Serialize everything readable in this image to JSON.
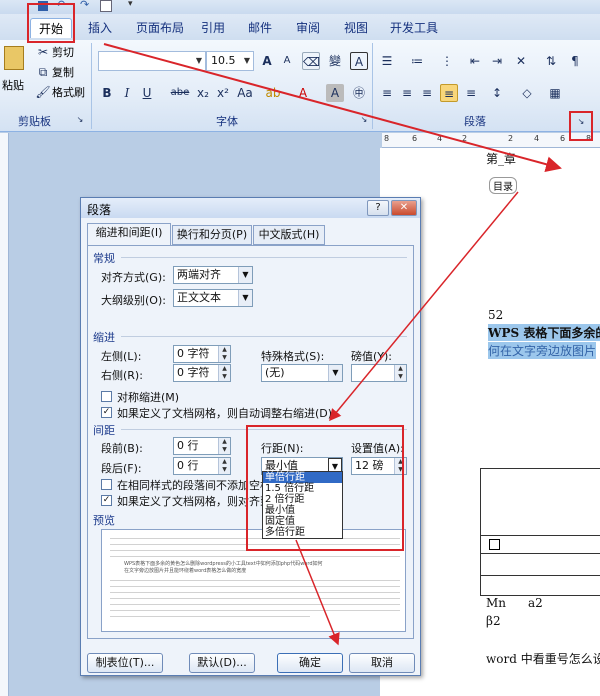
{
  "ribbon": {
    "tabs": [
      "开始",
      "插入",
      "页面布局",
      "引用",
      "邮件",
      "审阅",
      "视图",
      "开发工具"
    ],
    "clipboard": {
      "paste": "粘贴",
      "cut": "剪切",
      "copy": "复制",
      "format_painter": "格式刷",
      "label": "剪贴板"
    },
    "font": {
      "size": "10.5",
      "label": "字体",
      "bold": "B",
      "italic": "I",
      "underline": "U",
      "strike": "abe",
      "subscript": "x₂",
      "superscript": "x²",
      "change_case": "Aa",
      "grow": "A",
      "shrink": "A",
      "phonetic": "變",
      "border": "A",
      "color": "A",
      "shade": "A",
      "enclose": "㊥"
    },
    "paragraph": {
      "label": "段落"
    }
  },
  "ruler": [
    "8",
    "6",
    "4",
    "2",
    "2",
    "4",
    "6",
    "8"
  ],
  "document": {
    "line1": "第_章",
    "toc": "目录",
    "num": "52",
    "wps_line": "WPS 表格下面多余的",
    "wps_line2": "何在文字旁边放图片",
    "mn": "Mn",
    "a2": "a2",
    "beta": "β2",
    "word_line": "word 中看重号怎么设"
  },
  "dialog": {
    "title": "段落",
    "help": "?",
    "close": "✕",
    "tabs": [
      "缩进和间距(I)",
      "换行和分页(P)",
      "中文版式(H)"
    ],
    "general": {
      "heading": "常规",
      "align_label": "对齐方式(G):",
      "align_value": "两端对齐",
      "outline_label": "大纲级别(O):",
      "outline_value": "正文文本"
    },
    "indent": {
      "heading": "缩进",
      "left_label": "左侧(L):",
      "left_value": "0 字符",
      "right_label": "右侧(R):",
      "right_value": "0 字符",
      "special_label": "特殊格式(S):",
      "special_value": "(无)",
      "by_label": "磅值(Y):",
      "mirror": "对称缩进(M)",
      "auto_adjust": "如果定义了文档网格，则自动调整右缩进(D)"
    },
    "spacing": {
      "heading": "间距",
      "before_label": "段前(B):",
      "before_value": "0 行",
      "after_label": "段后(F):",
      "after_value": "0 行",
      "line_label": "行距(N):",
      "line_value": "最小值",
      "at_label": "设置值(A):",
      "at_value": "12 磅",
      "no_space": "在相同样式的段落间不添加空格",
      "snap_grid": "如果定义了文档网格，则对齐到"
    },
    "line_options": [
      "单倍行距",
      "1.5 倍行距",
      "2 倍行距",
      "最小值",
      "固定值",
      "多倍行距"
    ],
    "preview": {
      "heading": "预览",
      "sample1": "WPS表格下面多余的黄色怎么删除wordpress的小工具text中如何添加php代码word如何",
      "sample2": "在文字旁边放图片并且能环绕着word表格怎么做的宽度"
    },
    "buttons": {
      "tabs": "制表位(T)...",
      "default": "默认(D)...",
      "ok": "确定",
      "cancel": "取消"
    }
  },
  "colors": {
    "annotation": "#d9252a",
    "selection": "#316ac5"
  }
}
